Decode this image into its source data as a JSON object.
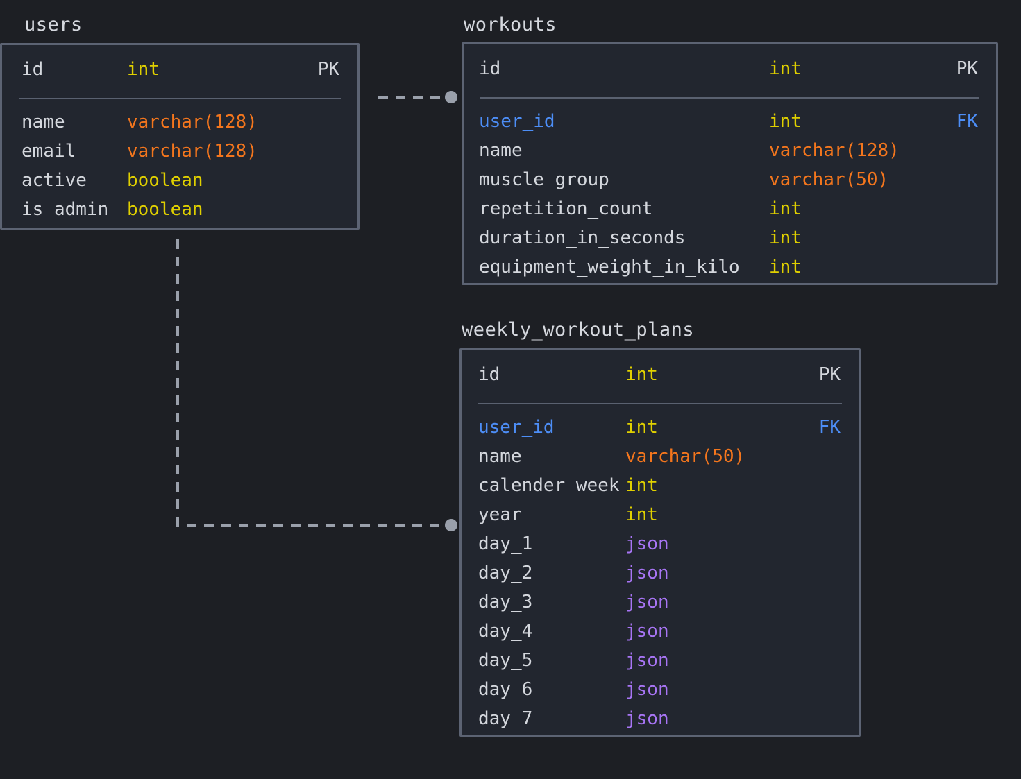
{
  "theme": {
    "background": "#1d1f24",
    "entity_fill": "#22262f",
    "entity_border": "#5c6373",
    "divider": "#5a6170",
    "text_default": "#d4d7dd",
    "type_int": "#e0d000",
    "type_boolean": "#e0d000",
    "type_varchar": "#f4761d",
    "type_json": "#a875f5",
    "foreign_key": "#4d8ef7",
    "connector": "#9aa0ab"
  },
  "diagram": {
    "type": "entity-relationship-diagram",
    "entities": [
      {
        "id": "users",
        "title": "users",
        "primary": {
          "name": "id",
          "type": "int",
          "key": "PK"
        },
        "columns": [
          {
            "name": "name",
            "type": "varchar(128)",
            "type_class": "varchar",
            "key": ""
          },
          {
            "name": "email",
            "type": "varchar(128)",
            "type_class": "varchar",
            "key": ""
          },
          {
            "name": "active",
            "type": "boolean",
            "type_class": "boolean",
            "key": ""
          },
          {
            "name": "is_admin",
            "type": "boolean",
            "type_class": "boolean",
            "key": ""
          }
        ]
      },
      {
        "id": "workouts",
        "title": "workouts",
        "primary": {
          "name": "id",
          "type": "int",
          "key": "PK"
        },
        "columns": [
          {
            "name": "user_id",
            "type": "int",
            "type_class": "int",
            "key": "FK"
          },
          {
            "name": "name",
            "type": "varchar(128)",
            "type_class": "varchar",
            "key": ""
          },
          {
            "name": "muscle_group",
            "type": "varchar(50)",
            "type_class": "varchar",
            "key": ""
          },
          {
            "name": "repetition_count",
            "type": "int",
            "type_class": "int",
            "key": ""
          },
          {
            "name": "duration_in_seconds",
            "type": "int",
            "type_class": "int",
            "key": ""
          },
          {
            "name": "equipment_weight_in_kilo",
            "type": "int",
            "type_class": "int",
            "key": ""
          }
        ]
      },
      {
        "id": "weekly_workout_plans",
        "title": "weekly_workout_plans",
        "primary": {
          "name": "id",
          "type": "int",
          "key": "PK"
        },
        "columns": [
          {
            "name": "user_id",
            "type": "int",
            "type_class": "int",
            "key": "FK"
          },
          {
            "name": "name",
            "type": "varchar(50)",
            "type_class": "varchar",
            "key": ""
          },
          {
            "name": "calender_week",
            "type": "int",
            "type_class": "int",
            "key": ""
          },
          {
            "name": "year",
            "type": "int",
            "type_class": "int",
            "key": ""
          },
          {
            "name": "day_1",
            "type": "json",
            "type_class": "json",
            "key": ""
          },
          {
            "name": "day_2",
            "type": "json",
            "type_class": "json",
            "key": ""
          },
          {
            "name": "day_3",
            "type": "json",
            "type_class": "json",
            "key": ""
          },
          {
            "name": "day_4",
            "type": "json",
            "type_class": "json",
            "key": ""
          },
          {
            "name": "day_5",
            "type": "json",
            "type_class": "json",
            "key": ""
          },
          {
            "name": "day_6",
            "type": "json",
            "type_class": "json",
            "key": ""
          },
          {
            "name": "day_7",
            "type": "json",
            "type_class": "json",
            "key": ""
          }
        ]
      }
    ],
    "relationships": [
      {
        "from": "users.id",
        "to": "workouts.user_id",
        "style": "dashed",
        "endpoint": "circle"
      },
      {
        "from": "users.id",
        "to": "weekly_workout_plans.user_id",
        "style": "dashed",
        "endpoint": "circle"
      }
    ]
  }
}
